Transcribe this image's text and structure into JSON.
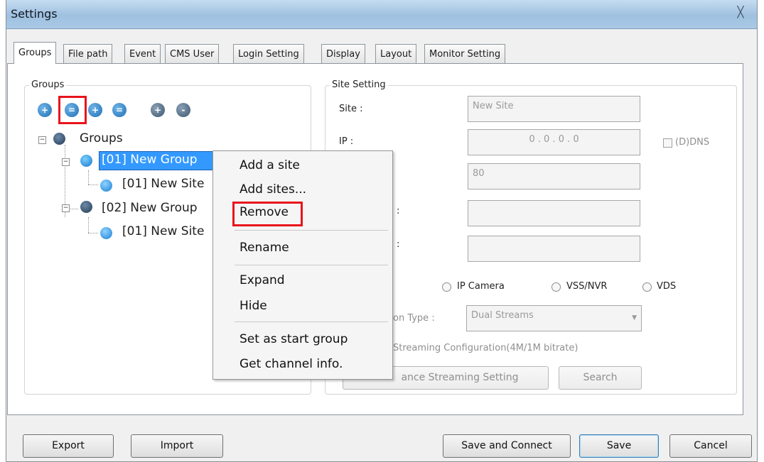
{
  "window": {
    "title": "Settings",
    "close_glyph": "╳"
  },
  "tabs": [
    {
      "label": "Groups",
      "active": true
    },
    {
      "label": "File path"
    },
    {
      "label": "Event"
    },
    {
      "label": "CMS User"
    },
    {
      "label": "Login Setting"
    },
    {
      "label": "Display"
    },
    {
      "label": "Layout"
    },
    {
      "label": "Monitor Setting"
    }
  ],
  "groups_panel": {
    "legend": "Groups",
    "toolbar_icons": [
      "add-group-icon",
      "add-site-icon",
      "add-icon",
      "remove-icon",
      "zoom-in-icon",
      "zoom-out-icon"
    ],
    "tree": {
      "root": "Groups",
      "groups": [
        {
          "label": "[01] New Group",
          "selected": true,
          "sites": [
            "[01] New Site"
          ]
        },
        {
          "label": "[02] New Group",
          "sites": [
            "[01] New Site"
          ]
        }
      ]
    }
  },
  "site_setting": {
    "legend": "Site Setting",
    "site_label": "Site :",
    "site_value": "New Site",
    "ip_label": "IP :",
    "ip_value": "0   .   0   .   0   .   0",
    "ddns_label": "(D)DNS",
    "port_value": "80",
    "colon": ":",
    "device_types": [
      "IP Camera",
      "VSS/NVR",
      "VDS"
    ],
    "type_label_partial": "on Type :",
    "type_value": "Dual Streams",
    "streaming_config": "Streaming Configuration(4M/1M bitrate)",
    "advance_button_partial": "ance Streaming Setting",
    "search_button": "Search"
  },
  "context_menu": {
    "items": [
      "Add a site",
      "Add sites...",
      "Remove",
      "Rename",
      "Expand",
      "Hide",
      "Set as start group",
      "Get channel info."
    ],
    "highlighted": "Remove"
  },
  "footer": {
    "export": "Export",
    "import": "Import",
    "save_and_connect": "Save and Connect",
    "save": "Save",
    "cancel": "Cancel"
  },
  "colors": {
    "selection": "#3399ff",
    "highlight_box": "#e8141b",
    "title_bar": "#a9c9e6"
  }
}
